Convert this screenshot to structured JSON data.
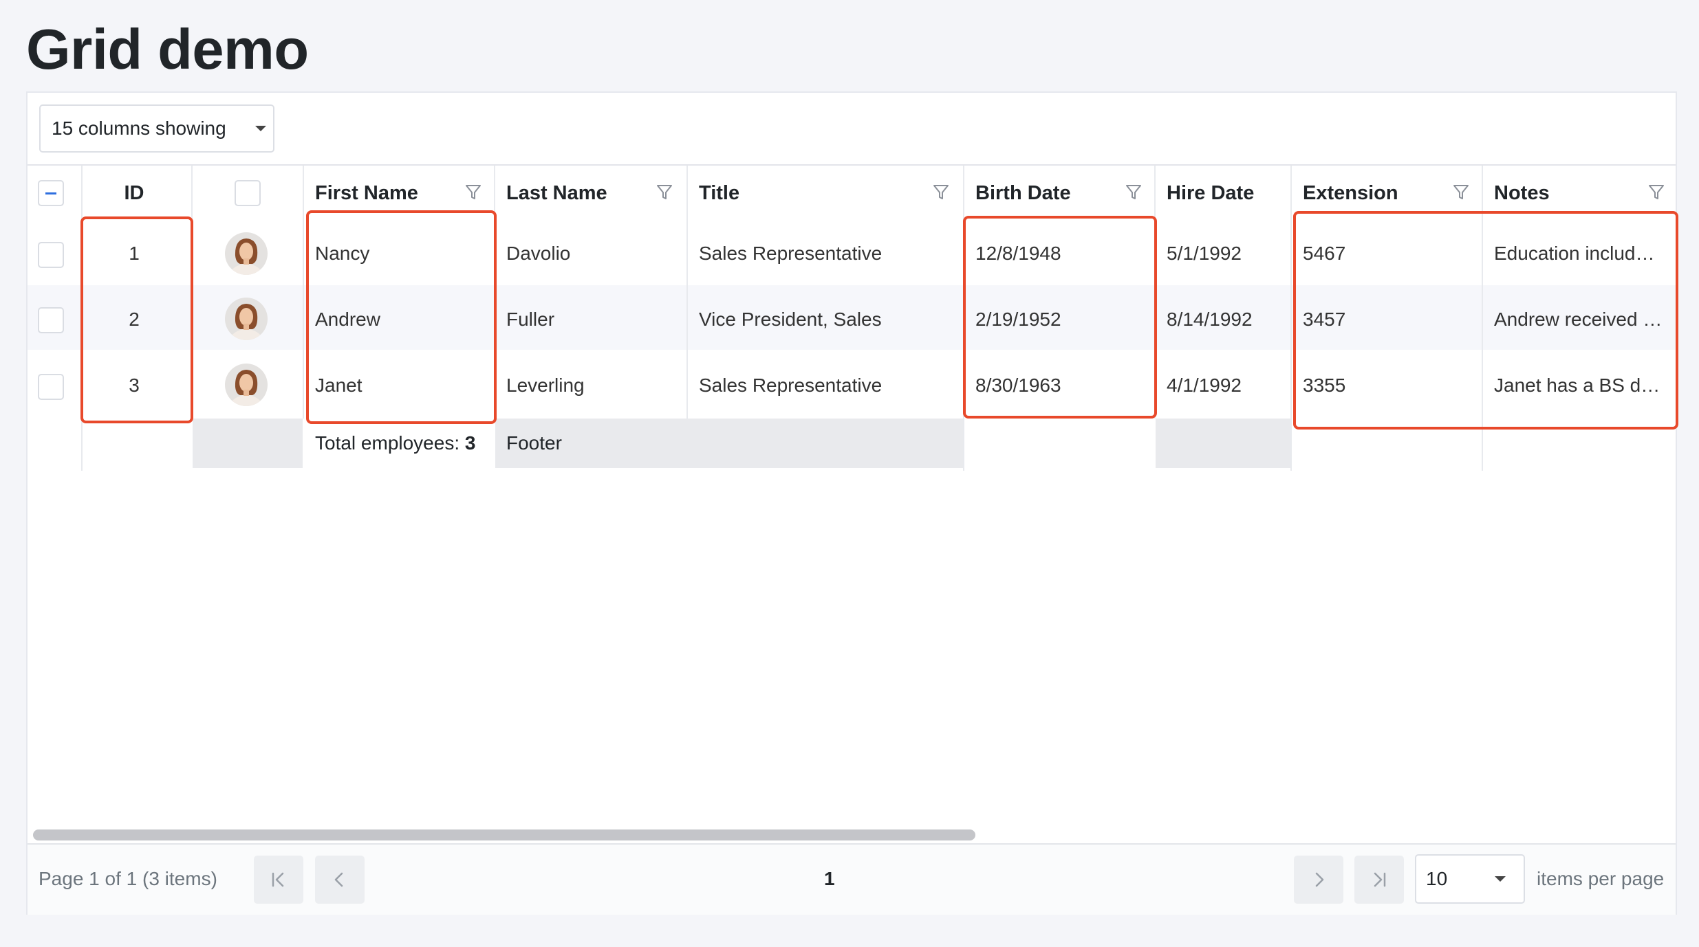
{
  "page": {
    "title": "Grid demo"
  },
  "toolbar": {
    "columns_showing": "15 columns showing"
  },
  "columns": {
    "id": "ID",
    "first_name": "First Name",
    "last_name": "Last Name",
    "title": "Title",
    "birth_date": "Birth Date",
    "hire_date": "Hire Date",
    "extension": "Extension",
    "notes": "Notes"
  },
  "rows": [
    {
      "id": "1",
      "first_name": "Nancy",
      "last_name": "Davolio",
      "title": "Sales Representative",
      "birth_date": "12/8/1948",
      "hire_date": "5/1/1992",
      "extension": "5467",
      "notes": "Education includ…"
    },
    {
      "id": "2",
      "first_name": "Andrew",
      "last_name": "Fuller",
      "title": "Vice President, Sales",
      "birth_date": "2/19/1952",
      "hire_date": "8/14/1992",
      "extension": "3457",
      "notes": "Andrew received …"
    },
    {
      "id": "3",
      "first_name": "Janet",
      "last_name": "Leverling",
      "title": "Sales Representative",
      "birth_date": "8/30/1963",
      "hire_date": "4/1/1992",
      "extension": "3355",
      "notes": "Janet has a BS d…"
    }
  ],
  "footer": {
    "total_label": "Total employees: ",
    "total_value": "3",
    "last_name": "Footer"
  },
  "pager": {
    "info": "Page 1 of 1 (3 items)",
    "current_page": "1",
    "page_size": "10",
    "items_per_page": "items per page"
  },
  "icons": {
    "filter": "filter-icon",
    "first": "first-page-icon",
    "prev": "prev-page-icon",
    "next": "next-page-icon",
    "last": "last-page-icon",
    "dropdown": "chevron-down-icon"
  },
  "colors": {
    "highlight": "#e8492b",
    "checkbox_accent": "#2f6fdf",
    "page_bg": "#f4f5f9"
  }
}
